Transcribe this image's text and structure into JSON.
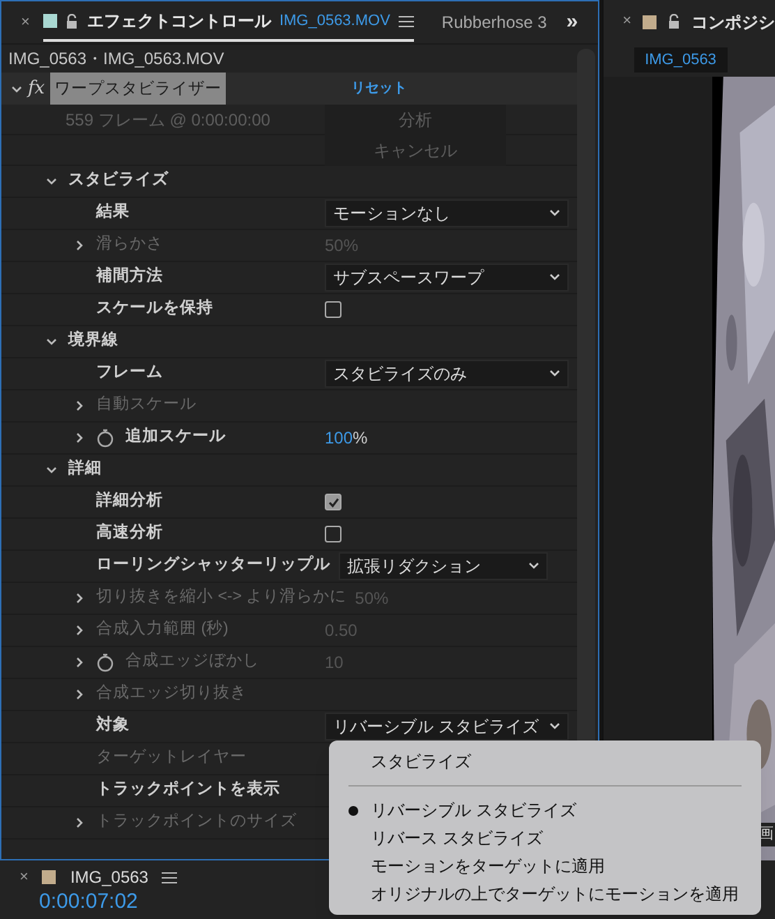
{
  "effects_panel": {
    "close": "×",
    "tabs": [
      {
        "label": "エフェクトコントロール",
        "file": "IMG_0563.MOV",
        "selected": true
      },
      {
        "label": "Rubberhose 3",
        "selected": false
      }
    ],
    "overflow": "»",
    "header": "IMG_0563・IMG_0563.MOV",
    "effect": {
      "fx": "fx",
      "name": "ワープスタビライザー",
      "reset": "リセット",
      "status": "559 フレーム @ 0:00:00:00",
      "analyze": "分析",
      "cancel": "キャンセル"
    },
    "properties": [
      {
        "kind": "section",
        "label": "スタビライズ",
        "expanded": true,
        "children": [
          {
            "kind": "dropdown",
            "label": "結果",
            "value": "モーションなし",
            "disabled": false
          },
          {
            "kind": "value",
            "label": "滑らかさ",
            "value": "50%",
            "disabled": true,
            "expandable": true
          },
          {
            "kind": "dropdown",
            "label": "補間方法",
            "value": "サブスペースワープ",
            "disabled": false
          },
          {
            "kind": "checkbox",
            "label": "スケールを保持",
            "checked": false,
            "disabled": false
          }
        ]
      },
      {
        "kind": "section",
        "label": "境界線",
        "expanded": true,
        "children": [
          {
            "kind": "dropdown",
            "label": "フレーム",
            "value": "スタビライズのみ",
            "disabled": false
          },
          {
            "kind": "plain",
            "label": "自動スケール",
            "disabled": true,
            "expandable": true
          },
          {
            "kind": "value",
            "label": "追加スケール",
            "value": "100",
            "unit": "%",
            "disabled": false,
            "expandable": true,
            "stopwatch": true
          }
        ]
      },
      {
        "kind": "section",
        "label": "詳細",
        "expanded": true,
        "children": [
          {
            "kind": "checkbox",
            "label": "詳細分析",
            "checked": true,
            "disabled": false
          },
          {
            "kind": "checkbox",
            "label": "高速分析",
            "checked": false,
            "disabled": false
          },
          {
            "kind": "dropdown",
            "label": "ローリングシャッターリップル",
            "value": "拡張リダクション",
            "disabled": false,
            "narrow": true
          },
          {
            "kind": "value",
            "label": "切り抜きを縮小 <-> より滑らかに",
            "value": "50%",
            "disabled": true,
            "expandable": true
          },
          {
            "kind": "value",
            "label": "合成入力範囲 (秒)",
            "value": "0.50",
            "disabled": true,
            "expandable": true
          },
          {
            "kind": "value",
            "label": "合成エッジぼかし",
            "value": "10",
            "disabled": true,
            "expandable": true,
            "stopwatch": true
          },
          {
            "kind": "plain",
            "label": "合成エッジ切り抜き",
            "disabled": true,
            "expandable": true
          },
          {
            "kind": "dropdown",
            "label": "対象",
            "value": "リバーシブル スタビライズ",
            "disabled": false
          },
          {
            "kind": "plain",
            "label": "ターゲットレイヤー",
            "disabled": true
          },
          {
            "kind": "plain",
            "label": "トラックポイントを表示",
            "disabled": false
          },
          {
            "kind": "plain",
            "label": "トラックポイントのサイズ",
            "disabled": true,
            "expandable": true
          }
        ]
      }
    ]
  },
  "composition_panel": {
    "close": "×",
    "tab": "コンポジシ",
    "layer_tab": "IMG_0563",
    "edge_text": "画"
  },
  "timeline_panel": {
    "close": "×",
    "tab": "IMG_0563",
    "timecode": "0:00:07:02"
  },
  "dropdown_menu": {
    "items": [
      {
        "kind": "item",
        "label": "スタビライズ",
        "selected": false
      },
      {
        "kind": "separator"
      },
      {
        "kind": "item",
        "label": "リバーシブル スタビライズ",
        "selected": true
      },
      {
        "kind": "item",
        "label": "リバース スタビライズ",
        "selected": false
      },
      {
        "kind": "item",
        "label": "モーションをターゲットに適用",
        "selected": false
      },
      {
        "kind": "item",
        "label": "オリジナルの上でターゲットにモーションを適用",
        "selected": false
      }
    ]
  }
}
